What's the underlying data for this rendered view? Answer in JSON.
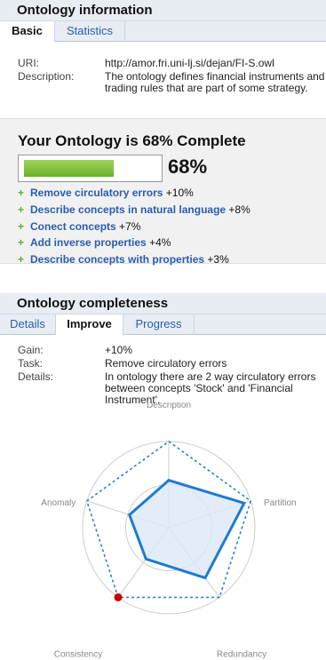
{
  "info_panel": {
    "title": "Ontology information",
    "tabs": [
      {
        "label": "Basic"
      },
      {
        "label": "Statistics"
      }
    ],
    "uri_label": "URI:",
    "uri_value": "http://amor.fri.uni-lj.si/dejan/FI-S.owl",
    "desc_label": "Description:",
    "desc_value": "The ontology defines financial instruments and trading rules that are part of some strategy."
  },
  "completeness_summary": {
    "title": "Your Ontology is 68% Complete",
    "percent_text": "68%",
    "progress_fraction": 0.68,
    "suggestions": [
      {
        "label": "Remove circulatory errors",
        "gain": "+10%"
      },
      {
        "label": "Describe concepts in natural language",
        "gain": "+8%"
      },
      {
        "label": "Conect concepts",
        "gain": "+7%"
      },
      {
        "label": "Add inverse properties",
        "gain": "+4%"
      },
      {
        "label": "Describe concepts with properties",
        "gain": "+3%"
      }
    ]
  },
  "completeness_panel": {
    "title": "Ontology completeness",
    "tabs": [
      {
        "label": "Details"
      },
      {
        "label": "Improve"
      },
      {
        "label": "Progress"
      }
    ],
    "gain_label": "Gain:",
    "gain_value": "+10%",
    "task_label": "Task:",
    "task_value": "Remove circulatory errors",
    "details_label": "Details:",
    "details_value": "In ontology there are 2 way circulatory errors between concepts 'Stock' and 'Financial Instrument'."
  },
  "radar": {
    "axes": [
      "Description",
      "Partition",
      "Redundancy",
      "Consistency",
      "Anomaly"
    ],
    "current": [
      0.55,
      0.92,
      0.72,
      0.45,
      0.48
    ],
    "target": [
      1.0,
      1.0,
      1.0,
      1.0,
      1.0
    ],
    "highlight_axis_index": 3,
    "colors": {
      "line": "#1e7bd0",
      "fill": "#dbe9f7",
      "dot": "#c40000",
      "grid": "#cccccc"
    }
  }
}
